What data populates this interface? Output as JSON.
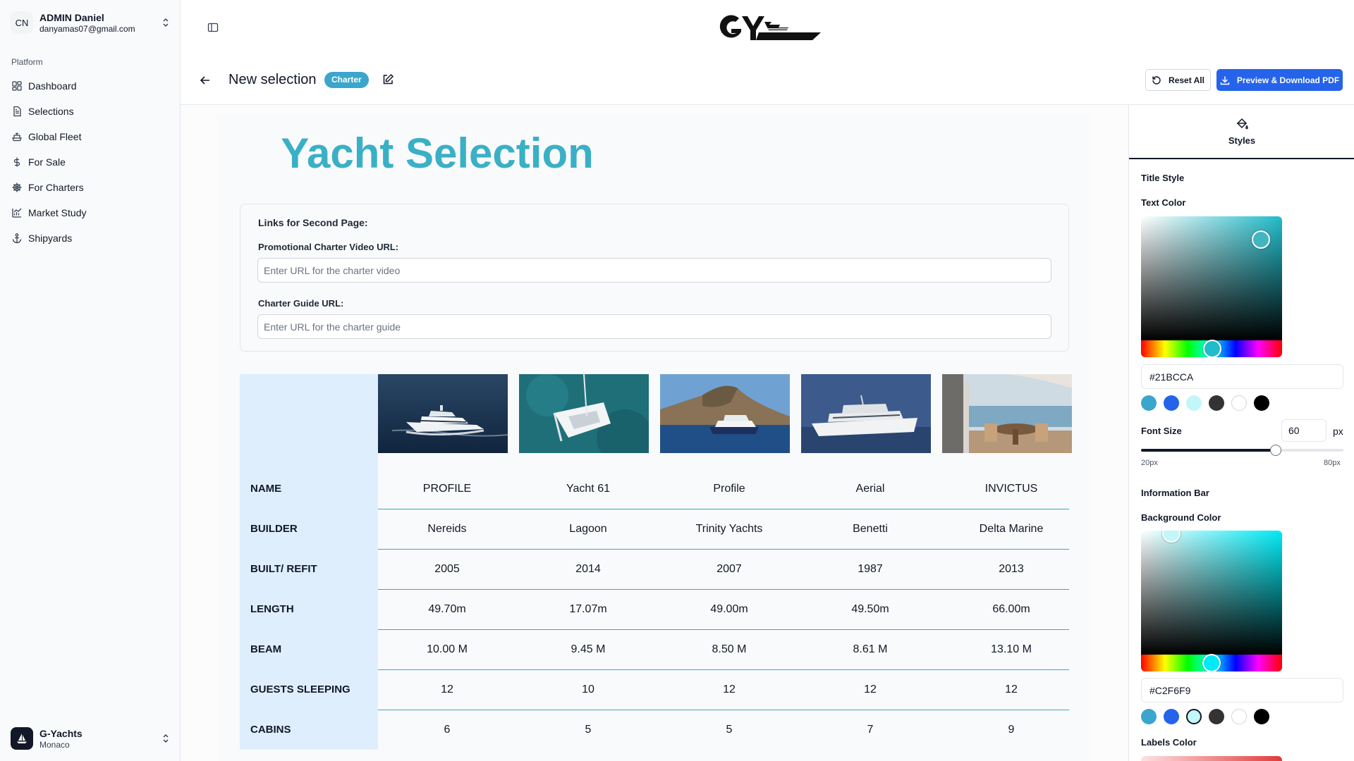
{
  "user": {
    "initials": "CN",
    "name": "ADMIN Daniel",
    "email": "danyamas07@gmail.com"
  },
  "sidebar": {
    "section_label": "Platform",
    "items": [
      {
        "label": "Dashboard",
        "icon": "dashboard-icon"
      },
      {
        "label": "Selections",
        "icon": "document-icon"
      },
      {
        "label": "Global Fleet",
        "icon": "ship-icon"
      },
      {
        "label": "For Sale",
        "icon": "dollar-icon"
      },
      {
        "label": "For Charters",
        "icon": "helm-icon"
      },
      {
        "label": "Market Study",
        "icon": "chart-icon"
      },
      {
        "label": "Shipyards",
        "icon": "anchor-icon"
      }
    ]
  },
  "org": {
    "name": "G-Yachts",
    "location": "Monaco"
  },
  "header": {
    "title": "New selection",
    "badge": "Charter",
    "reset_label": "Reset All",
    "pdf_label": "Preview & Download PDF"
  },
  "document": {
    "title": "Yacht Selection",
    "title_color": "#3AB0C6",
    "links_heading": "Links for Second Page:",
    "video_label": "Promotional Charter Video URL:",
    "video_placeholder": "Enter URL for the charter video",
    "video_value": "",
    "guide_label": "Charter Guide URL:",
    "guide_placeholder": "Enter URL for the charter guide",
    "guide_value": ""
  },
  "table": {
    "label_column_color": "#DFEEFC",
    "images": [
      "motor-yacht-photo",
      "catamaran-photo",
      "superyacht-coast-photo",
      "classic-yacht-photo",
      "aft-deck-photo"
    ],
    "rows": [
      {
        "label": "NAME",
        "values": [
          "PROFILE",
          "Yacht 61",
          "Profile",
          "Aerial",
          "INVICTUS"
        ]
      },
      {
        "label": "BUILDER",
        "values": [
          "Nereids",
          "Lagoon",
          "Trinity Yachts",
          "Benetti",
          "Delta Marine"
        ]
      },
      {
        "label": "BUILT/ REFIT",
        "values": [
          "2005",
          "2014",
          "2007",
          "1987",
          "2013"
        ]
      },
      {
        "label": "LENGTH",
        "values": [
          "49.70m",
          "17.07m",
          "49.00m",
          "49.50m",
          "66.00m"
        ]
      },
      {
        "label": "BEAM",
        "values": [
          "10.00 M",
          "9.45 M",
          "8.50 M",
          "8.61 M",
          "13.10 M"
        ]
      },
      {
        "label": "GUESTS SLEEPING",
        "values": [
          "12",
          "10",
          "12",
          "12",
          "12"
        ]
      },
      {
        "label": "CABINS",
        "values": [
          "6",
          "5",
          "5",
          "7",
          "9"
        ]
      }
    ]
  },
  "panel": {
    "tab_label": "Styles",
    "title_style_heading": "Title Style",
    "text_color_label": "Text Color",
    "text_color_value": "#21BCCA",
    "font_size_label": "Font Size",
    "font_size_value": "60",
    "font_size_unit": "px",
    "font_size_min": "20px",
    "font_size_max": "80px",
    "font_size_level": 0.667,
    "info_bar_heading": "Information Bar",
    "bg_color_label": "Background Color",
    "bg_color_value": "#C2F6F9",
    "labels_color_label": "Labels Color",
    "swatches": [
      "#3AA6CC",
      "#2563EB",
      "#C2F6F9",
      "#333333",
      "#FFFFFF",
      "#000000"
    ]
  }
}
